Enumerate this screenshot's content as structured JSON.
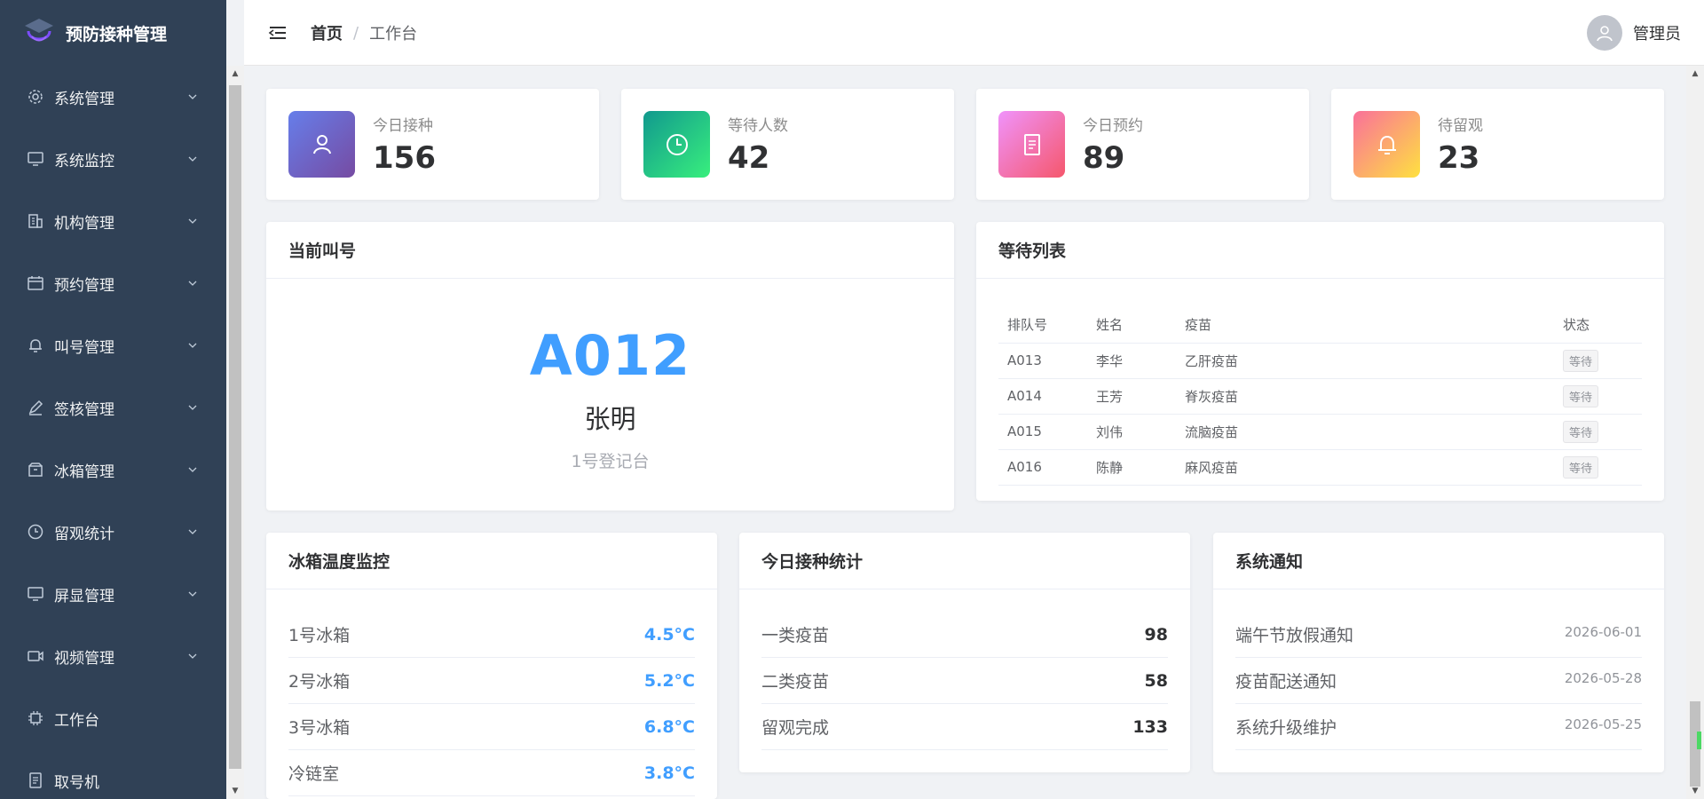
{
  "app": {
    "title": "预防接种管理"
  },
  "colors": {
    "sidebar_bg": "#304156",
    "accent": "#409eff"
  },
  "sidebar": {
    "items": [
      {
        "label": "系统管理",
        "icon": "gear-icon",
        "expandable": true
      },
      {
        "label": "系统监控",
        "icon": "monitor-icon",
        "expandable": true
      },
      {
        "label": "机构管理",
        "icon": "building-icon",
        "expandable": true
      },
      {
        "label": "预约管理",
        "icon": "calendar-icon",
        "expandable": true
      },
      {
        "label": "叫号管理",
        "icon": "bell-icon",
        "expandable": true
      },
      {
        "label": "签核管理",
        "icon": "pen-icon",
        "expandable": true
      },
      {
        "label": "冰箱管理",
        "icon": "box-icon",
        "expandable": true
      },
      {
        "label": "留观统计",
        "icon": "clock-icon",
        "expandable": true
      },
      {
        "label": "屏显管理",
        "icon": "monitor-icon",
        "expandable": true
      },
      {
        "label": "视频管理",
        "icon": "video-icon",
        "expandable": true
      },
      {
        "label": "工作台",
        "icon": "chip-icon",
        "expandable": false
      },
      {
        "label": "取号机",
        "icon": "document-icon",
        "expandable": false
      }
    ]
  },
  "header": {
    "breadcrumb": {
      "home": "首页",
      "separator": "/",
      "current": "工作台"
    },
    "user": "管理员"
  },
  "stats": [
    {
      "label": "今日接种",
      "value": "156",
      "icon": "user-icon"
    },
    {
      "label": "等待人数",
      "value": "42",
      "icon": "clock-icon"
    },
    {
      "label": "今日预约",
      "value": "89",
      "icon": "document-icon"
    },
    {
      "label": "待留观",
      "value": "23",
      "icon": "bell-icon"
    }
  ],
  "calling": {
    "title": "当前叫号",
    "number": "A012",
    "name": "张明",
    "desk": "1号登记台"
  },
  "wait_list": {
    "title": "等待列表",
    "columns": [
      "排队号",
      "姓名",
      "疫苗",
      "状态"
    ],
    "rows": [
      [
        "A013",
        "李华",
        "乙肝疫苗",
        "等待"
      ],
      [
        "A014",
        "王芳",
        "脊灰疫苗",
        "等待"
      ],
      [
        "A015",
        "刘伟",
        "流脑疫苗",
        "等待"
      ],
      [
        "A016",
        "陈静",
        "麻风疫苗",
        "等待"
      ]
    ]
  },
  "fridge": {
    "title": "冰箱温度监控",
    "rows": [
      {
        "label": "1号冰箱",
        "value": "4.5°C"
      },
      {
        "label": "2号冰箱",
        "value": "5.2°C"
      },
      {
        "label": "3号冰箱",
        "value": "6.8°C"
      },
      {
        "label": "冷链室",
        "value": "3.8°C"
      }
    ]
  },
  "today_stats": {
    "title": "今日接种统计",
    "rows": [
      {
        "label": "一类疫苗",
        "value": "98"
      },
      {
        "label": "二类疫苗",
        "value": "58"
      },
      {
        "label": "留观完成",
        "value": "133"
      }
    ]
  },
  "notices": {
    "title": "系统通知",
    "rows": [
      {
        "label": "端午节放假通知",
        "date": "2026-06-01"
      },
      {
        "label": "疫苗配送通知",
        "date": "2026-05-28"
      },
      {
        "label": "系统升级维护",
        "date": "2026-05-25"
      }
    ]
  }
}
